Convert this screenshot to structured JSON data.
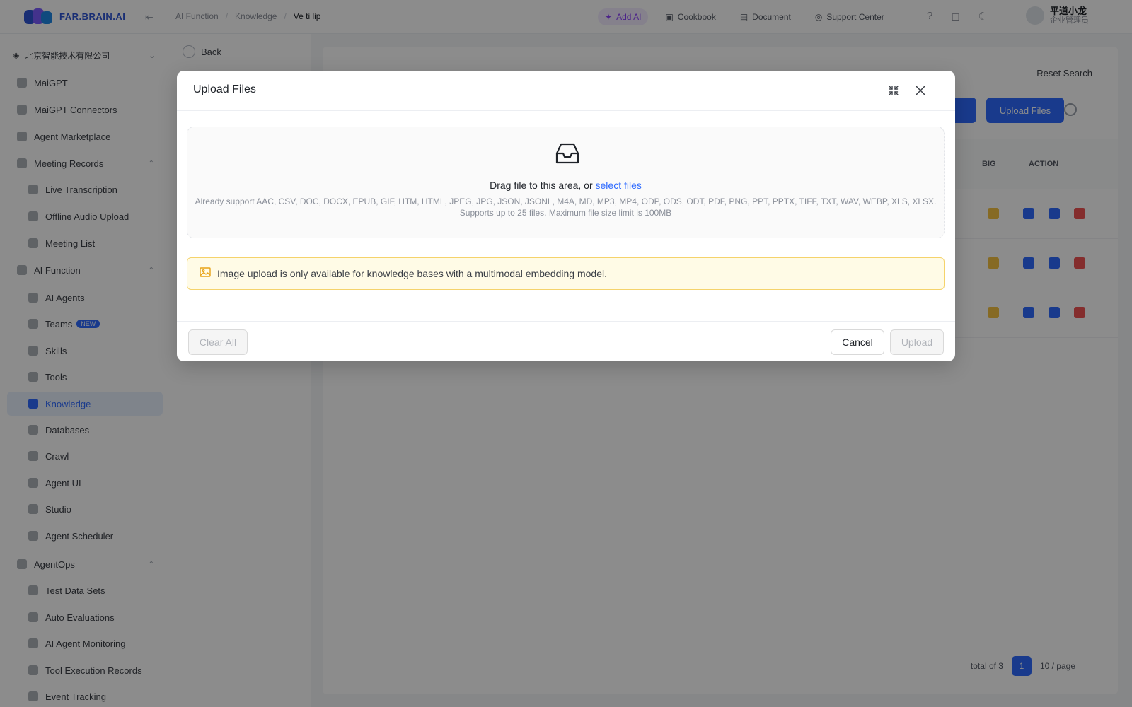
{
  "app": {
    "brand": "FAR.BRAIN.AI",
    "breadcrumb": [
      "AI Function",
      "Knowledge",
      "Ve ti lip"
    ],
    "top_actions": [
      {
        "label": "Add AI",
        "icon": "star-icon"
      },
      {
        "label": "Cookbook",
        "icon": "book-icon"
      },
      {
        "label": "Document",
        "icon": "doc-icon"
      },
      {
        "label": "Support Center",
        "icon": "headset-icon"
      }
    ],
    "user": {
      "name": "平道小龙",
      "role": "企业管理员"
    }
  },
  "sidebar": {
    "workspace": "北京智能技术有限公司",
    "items": [
      {
        "label": "MaiGPT",
        "level": "top"
      },
      {
        "label": "MaiGPT Connectors",
        "level": "top"
      },
      {
        "label": "Agent Marketplace",
        "level": "top"
      },
      {
        "label": "Meeting Records",
        "level": "top",
        "caret": "⌃"
      },
      {
        "label": "Live Transcription",
        "level": "sub"
      },
      {
        "label": "Offline Audio Upload",
        "level": "sub"
      },
      {
        "label": "Meeting List",
        "level": "sub"
      },
      {
        "label": "AI Function",
        "level": "top",
        "caret": "⌃"
      },
      {
        "label": "AI Agents",
        "level": "sub"
      },
      {
        "label": "Teams",
        "level": "sub",
        "badge": "NEW"
      },
      {
        "label": "Skills",
        "level": "sub"
      },
      {
        "label": "Tools",
        "level": "sub"
      },
      {
        "label": "Knowledge",
        "level": "sub",
        "active": true
      },
      {
        "label": "Databases",
        "level": "sub"
      },
      {
        "label": "Crawl",
        "level": "sub"
      },
      {
        "label": "Agent UI",
        "level": "sub"
      },
      {
        "label": "Studio",
        "level": "sub"
      },
      {
        "label": "Agent Scheduler",
        "level": "sub"
      },
      {
        "label": "AgentOps",
        "level": "top",
        "caret": "⌃"
      },
      {
        "label": "Test Data Sets",
        "level": "sub"
      },
      {
        "label": "Auto Evaluations",
        "level": "sub"
      },
      {
        "label": "AI Agent Monitoring",
        "level": "sub"
      },
      {
        "label": "Tool Execution Records",
        "level": "sub"
      },
      {
        "label": "Event Tracking",
        "level": "sub"
      }
    ]
  },
  "kb_panel": {
    "back_label": "Back"
  },
  "main": {
    "reset_label": "Reset Search",
    "upload_button": "Upload Files",
    "columns": {
      "col_a": "BIG",
      "col_b": "ACTION"
    },
    "pager": {
      "total": "total of 3",
      "page": "1",
      "per_page": "10 / page"
    }
  },
  "modal": {
    "title": "Upload Files",
    "drop_text": "Drag file to this area, or ",
    "select_link": "select files",
    "formats_line": "Already support AAC, CSV, DOC, DOCX, EPUB, GIF, HTM, HTML, JPEG, JPG, JSON, JSONL, M4A, MD, MP3, MP4, ODP, ODS, ODT, PDF, PNG, PPT, PPTX, TIFF, TXT, WAV, WEBP, XLS, XLSX.",
    "limits_line": "Supports up to 25 files. Maximum file size limit is 100MB",
    "alert": "Image upload is only available for knowledge bases with a multimodal embedding model.",
    "clear_all": "Clear All",
    "cancel": "Cancel",
    "upload": "Upload"
  },
  "colors": {
    "primary": "#2f6bff",
    "alert_bg": "#fffbe6",
    "alert_border": "#f5d36b",
    "alert_icon": "#e8a317"
  }
}
